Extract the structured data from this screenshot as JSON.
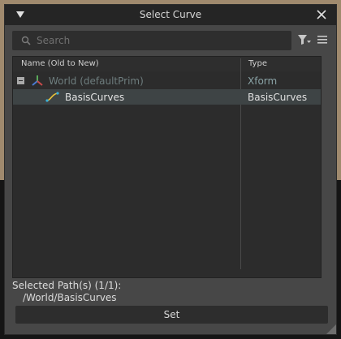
{
  "window": {
    "title": "Select Curve"
  },
  "search": {
    "placeholder": "Search",
    "value": ""
  },
  "tree": {
    "columns": [
      "Name (Old to New)",
      "Type"
    ],
    "rows": [
      {
        "name": "World (defaultPrim)",
        "type": "Xform",
        "icon": "xform-axes-icon",
        "expanded": true,
        "selected": false
      },
      {
        "name": "BasisCurves",
        "type": "BasisCurves",
        "icon": "basis-curves-icon",
        "selected": true
      }
    ]
  },
  "selection": {
    "label": "Selected Path(s) (1/1):",
    "path": "/World/BasisCurves"
  },
  "actions": {
    "set_label": "Set"
  },
  "colors": {
    "dialog_bg": "#474747",
    "titlebar_bg": "#252525",
    "tree_bg": "#2c2c2c",
    "selected_row_bg": "#3e4445",
    "dim_text": "#6e7d7e"
  }
}
